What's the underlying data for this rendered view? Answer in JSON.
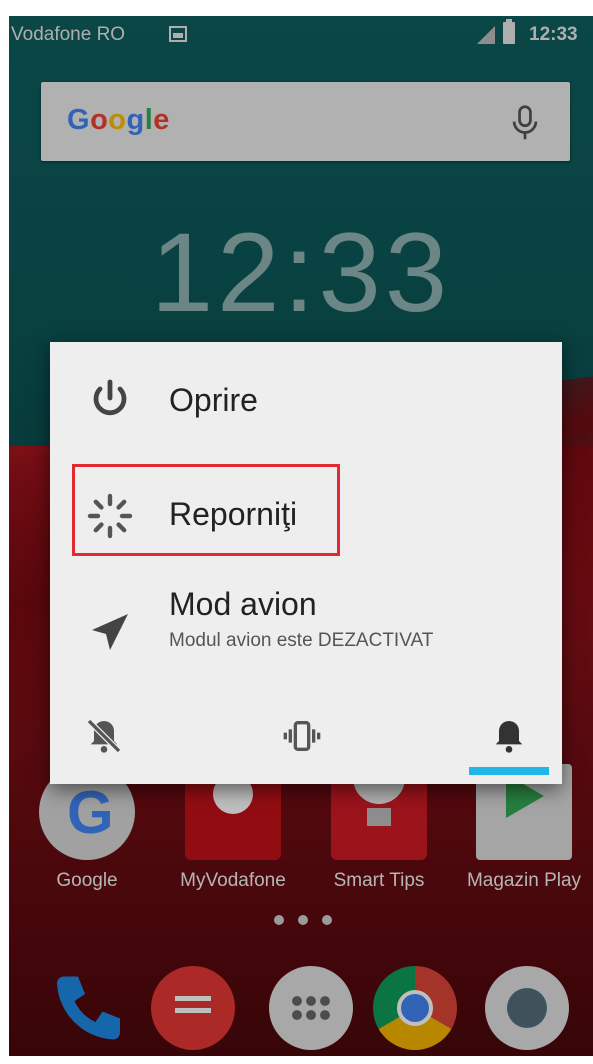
{
  "status_bar": {
    "carrier": "Vodafone RO",
    "time": "12:33"
  },
  "search_bar": {
    "logo": "Google"
  },
  "home": {
    "clock": "12:33",
    "apps": [
      {
        "label": "Google"
      },
      {
        "label": "MyVodafone"
      },
      {
        "label": "Smart Tips"
      },
      {
        "label": "Magazin Play"
      }
    ]
  },
  "power_menu": {
    "items": [
      {
        "label": "Oprire",
        "icon": "power-icon"
      },
      {
        "label": "Reporniţi",
        "icon": "restart-icon"
      },
      {
        "label": "Mod avion",
        "sublabel": "Modul avion este DEZACTIVAT",
        "icon": "airplane-icon"
      }
    ],
    "sound_modes": [
      "silent-icon",
      "vibrate-icon",
      "sound-on-icon"
    ],
    "selected_sound_mode": 2
  },
  "colors": {
    "highlight": "#e02b33",
    "accent": "#22b6e6"
  }
}
